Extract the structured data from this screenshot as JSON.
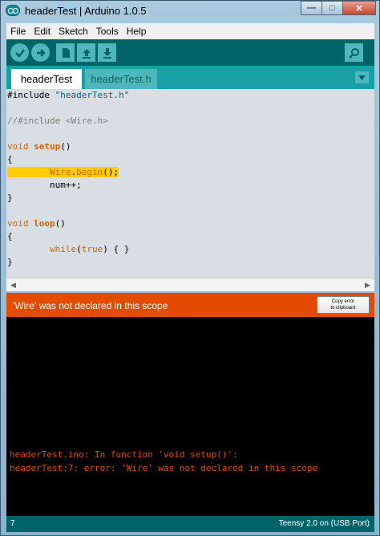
{
  "window": {
    "title": "headerTest | Arduino 1.0.5",
    "minimize_glyph": "—",
    "maximize_glyph": "□",
    "close_glyph": "✕"
  },
  "menu": [
    "File",
    "Edit",
    "Sketch",
    "Tools",
    "Help"
  ],
  "toolbar": {
    "verify_icon": "checkmark-icon",
    "upload_icon": "arrow-right-icon",
    "new_icon": "document-icon",
    "open_icon": "arrow-up-icon",
    "save_icon": "arrow-down-icon",
    "serial_icon": "magnifier-icon"
  },
  "tabs": [
    "headerTest",
    "headerTest.h"
  ],
  "code": {
    "l1_pre": "#include ",
    "l1_str": "\"headerTest.h\"",
    "l3": "//#include <Wire.h>",
    "l5_kw": "void",
    "l5_fn": "setup",
    "l5_rest": "()",
    "l6": "{",
    "l7_indent": "        ",
    "l7_obj": "Wire",
    "l7_dot": ".",
    "l7_call": "begin",
    "l7_rest": "();",
    "l8": "        num++;",
    "l9": "}",
    "l11_kw": "void",
    "l11_fn": "loop",
    "l11_rest": "()",
    "l12": "{",
    "l13_indent": "        ",
    "l13_kw": "while",
    "l13_p1": "(",
    "l13_val": "true",
    "l13_p2": ") { }",
    "l14": "}"
  },
  "error": {
    "message": "'Wire' was not declared in this scope",
    "copy_line1": "Copy error",
    "copy_line2": "to clipboard"
  },
  "console": [
    "headerTest.ino: In function 'void setup()':",
    "headerTest:7: error: 'Wire' was not declared in this scope"
  ],
  "status": {
    "line": "7",
    "board": "Teensy 2.0 on (USB Port)"
  },
  "colors": {
    "teal_dark": "#006468",
    "teal": "#17a1a5",
    "error": "#e34c00",
    "highlight": "#ffcc00",
    "keyword": "#cc6600"
  }
}
